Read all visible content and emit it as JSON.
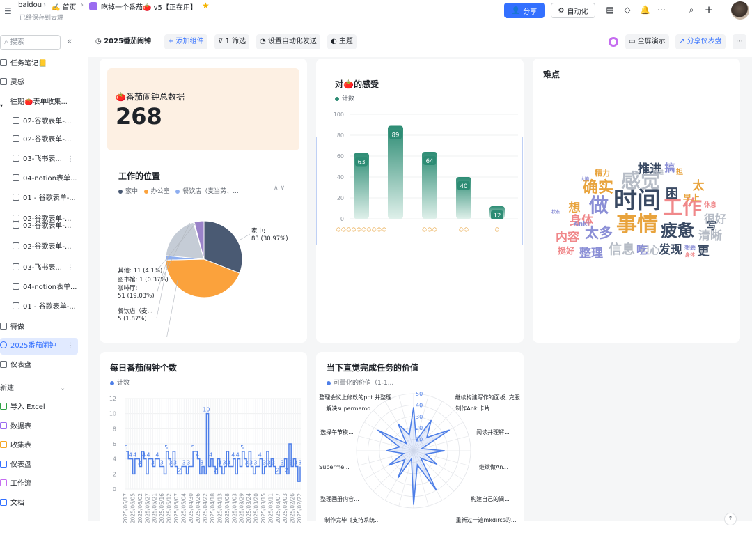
{
  "topbar": {
    "workspace": "baidou",
    "home": "✍️ 首页",
    "doc_title": "吃掉一个番茄🍅 v5【正在用】",
    "saved_status": "已经保存到云端",
    "share_label": "分享",
    "automation_label": "自动化"
  },
  "sidebar": {
    "search_placeholder": "搜索",
    "items": [
      {
        "label": "任务笔记📒"
      },
      {
        "label": "灵感"
      },
      {
        "label": "往期🍅表单收集..."
      },
      {
        "label": "02-谷歌表单-..."
      },
      {
        "label": "02-谷歌表单-..."
      },
      {
        "label": "03-飞书表..."
      },
      {
        "label": "04-notion表单..."
      },
      {
        "label": "01 - 谷歌表单-..."
      },
      {
        "label": "02-谷歌表单-..."
      },
      {
        "label": "02-谷歌表单-..."
      },
      {
        "label": "02-谷歌表单-..."
      },
      {
        "label": "03-飞书表..."
      },
      {
        "label": "04-notion表单..."
      },
      {
        "label": "01 - 谷歌表单-..."
      },
      {
        "label": "待做"
      },
      {
        "label": "2025番茄闹钟"
      },
      {
        "label": "仪表盘"
      }
    ],
    "new_section": "新建",
    "new_items": [
      {
        "label": "导入 Excel"
      },
      {
        "label": "数据表"
      },
      {
        "label": "收集表"
      },
      {
        "label": "仪表盘"
      },
      {
        "label": "工作流"
      },
      {
        "label": "文档"
      }
    ]
  },
  "toolbar": {
    "dashboard_name": "2025番茄闹钟",
    "add_widget": "添加组件",
    "filter": "1 筛选",
    "auto_send": "设置自动化发送",
    "theme": "主题",
    "fullscreen": "全屏演示",
    "share_dashboard": "分享仪表盘"
  },
  "colors": {
    "accent": "#3370ff",
    "teal": "#2d8c74",
    "blue": "#4e7fe8",
    "orange": "#fba23c",
    "navy": "#4a5a73"
  },
  "card_total": {
    "title": "🍅番茄闹钟总数据",
    "value": "268"
  },
  "card_location": {
    "title": "工作的位置",
    "legend": [
      "家中",
      "办公室",
      "餐饮店（麦当劳、..."
    ],
    "slice_labels": [
      {
        "name": "家中:",
        "value": "83 (30.97%)"
      },
      {
        "name": "办公室:",
        "value": "117 (43.66%)"
      },
      {
        "name": "餐饮店（麦...",
        "value": "5 (1.87%)"
      },
      {
        "name": "咖啡厅:",
        "value": "51 (19.03%)"
      },
      {
        "name": "图书馆:",
        "value": "1 (0.37%)"
      },
      {
        "name": "其他:",
        "value": "11 (4.1%)"
      }
    ]
  },
  "card_feeling": {
    "title": "对🍅的感受",
    "legend": "计数"
  },
  "card_difficulty": {
    "title": "难点",
    "words": [
      "时间",
      "事情",
      "工作",
      "做",
      "疲惫",
      "感觉",
      "确实",
      "太多",
      "身体",
      "发现",
      "信息",
      "整理",
      "推进",
      "内容",
      "担心",
      "太",
      "困",
      "想",
      "吃",
      "清晰",
      "很好",
      "写",
      "更",
      "精力",
      "搞",
      "挺好",
      "早上",
      "Anki",
      "休息",
      "担",
      "状态",
      "推进",
      "想要",
      "身体",
      "大脑"
    ]
  },
  "card_daily": {
    "title": "每日番茄闹钟个数",
    "legend": "计数"
  },
  "card_value": {
    "title": "当下直觉完成任务的价值",
    "legend": "可量化的价值（1-1...",
    "radar_labels": [
      "整理会议上修改的ppt 并整理...",
      "继续构建写作的面板, 克服...",
      "解决supermemo...",
      "制作Anki卡片",
      "选择午节模...",
      "阅读并理解...",
      "Superme...",
      "继续做An...",
      "整理画册内容...",
      "构建自己的阅...",
      "制作完毕《支持系统...",
      "重新过一遍mkdircs的..."
    ],
    "radar_ticks": [
      "10",
      "20",
      "30",
      "40",
      "50"
    ]
  },
  "chart_data": [
    {
      "type": "pie",
      "title": "工作的位置",
      "categories": [
        "家中",
        "办公室",
        "餐饮店（麦当劳、...",
        "咖啡厅",
        "图书馆",
        "其他"
      ],
      "values": [
        83,
        117,
        5,
        51,
        1,
        11
      ],
      "colors": [
        "#4a5a73",
        "#fba23c",
        "#8eaef0",
        "#c5ccd6",
        "#a9c8e6",
        "#9a82c9"
      ]
    },
    {
      "type": "bar",
      "title": "对🍅的感受",
      "series": [
        {
          "name": "计数",
          "values": [
            63,
            89,
            64,
            40,
            12
          ]
        }
      ],
      "categories": [
        "😊😊😊😊😊😊😊😊😊😊",
        "",
        "😊😊😊",
        "😊😊",
        "😊"
      ],
      "ylim": [
        0,
        100
      ],
      "yticks": [
        0,
        20,
        40,
        60,
        80,
        100
      ]
    },
    {
      "type": "line",
      "title": "每日番茄闹钟个数",
      "series": [
        {
          "name": "计数",
          "values": [
            5,
            4,
            4,
            2,
            4,
            4,
            3,
            5,
            4,
            2,
            4,
            4,
            3,
            4,
            4,
            3,
            3,
            2,
            5,
            4,
            3,
            5,
            3,
            2,
            2,
            3,
            3,
            2,
            3,
            3,
            5,
            5,
            4,
            2,
            3,
            2,
            10,
            3,
            4,
            3,
            2,
            4,
            3,
            2,
            3,
            5,
            3,
            3,
            4,
            2,
            4,
            3,
            5,
            4,
            3,
            5,
            3,
            2,
            3,
            3,
            4,
            2,
            3,
            5,
            3,
            4,
            3,
            2,
            2,
            3,
            3,
            4,
            2,
            6,
            3,
            4,
            3,
            1,
            3
          ]
        }
      ],
      "x_labels": [
        "2025/06/17",
        "2025/06/05",
        "2025/06/02",
        "2025/05/27",
        "2025/05/21",
        "2025/05/16",
        "2025/05/12",
        "2025/05/07",
        "2025/05/04",
        "2025/04/30",
        "2025/04/26",
        "2025/04/22",
        "2025/04/18",
        "2025/04/13",
        "2025/04/08",
        "2025/04/03",
        "2025/03/29",
        "2025/03/24",
        "2025/03/20",
        "2025/03/15",
        "2025/03/11",
        "2025/03/07",
        "2025/03/03",
        "2025/02/26",
        "2025/02/22"
      ],
      "ylim": [
        0,
        12
      ],
      "yticks": [
        0,
        2,
        4,
        6,
        8,
        10,
        12
      ]
    }
  ]
}
